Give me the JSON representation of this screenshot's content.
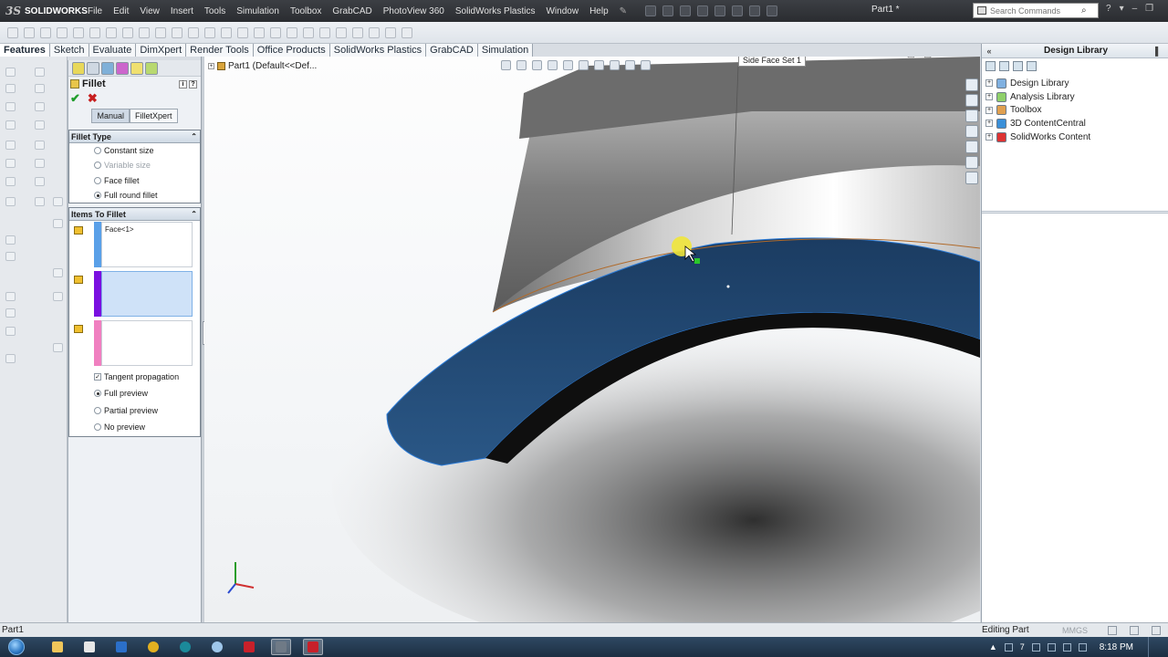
{
  "app": {
    "logo_text": "SOLIDWORKS",
    "logo_mark": "3S",
    "document_title": "Part1 *",
    "search_placeholder": "Search Commands",
    "menu": [
      "File",
      "Edit",
      "View",
      "Insert",
      "Tools",
      "Simulation",
      "Toolbox",
      "GrabCAD",
      "PhotoView 360",
      "SolidWorks Plastics",
      "Window",
      "Help"
    ]
  },
  "command_tabs": [
    "Features",
    "Sketch",
    "Evaluate",
    "DimXpert",
    "Render Tools",
    "Office Products",
    "SolidWorks Plastics",
    "GrabCAD",
    "Simulation"
  ],
  "property_manager": {
    "title": "Fillet",
    "modes": [
      "Manual",
      "FilletXpert"
    ],
    "fillet_type": {
      "title": "Fillet Type",
      "options": [
        {
          "label": "Constant size",
          "selected": false,
          "enabled": true
        },
        {
          "label": "Variable size",
          "selected": false,
          "enabled": false
        },
        {
          "label": "Face fillet",
          "selected": false,
          "enabled": true
        },
        {
          "label": "Full round fillet",
          "selected": true,
          "enabled": true
        }
      ]
    },
    "items_to_fillet": {
      "title": "Items To Fillet",
      "selection_boxes": [
        {
          "value": "Face<1>",
          "color": "#5aa0e8"
        },
        {
          "value": "",
          "color": "#7a10e0"
        },
        {
          "value": "",
          "color": "#f080c0"
        }
      ],
      "tangent_propagation": {
        "label": "Tangent propagation",
        "checked": true
      },
      "preview_options": [
        {
          "label": "Full preview",
          "selected": true
        },
        {
          "label": "Partial preview",
          "selected": false
        },
        {
          "label": "No preview",
          "selected": false
        }
      ]
    }
  },
  "viewport": {
    "feature_tree_text": "Part1  (Default<<Def...",
    "tooltip": "Side Face Set 1",
    "colors": {
      "face_selected": "#1f4268",
      "body": "#9a9a9a"
    }
  },
  "design_library": {
    "title": "Design Library",
    "items": [
      {
        "label": "Design Library",
        "icon": "library-icon"
      },
      {
        "label": "Analysis Library",
        "icon": "analysis-library-icon"
      },
      {
        "label": "Toolbox",
        "icon": "toolbox-icon"
      },
      {
        "label": "3D ContentCentral",
        "icon": "globe-icon"
      },
      {
        "label": "SolidWorks Content",
        "icon": "solidworks-content-icon"
      }
    ]
  },
  "status": {
    "left": "Part1",
    "mode": "Editing Part",
    "units": "MMGS"
  },
  "taskbar": {
    "tray_number": "7",
    "clock": "8:18 PM"
  }
}
